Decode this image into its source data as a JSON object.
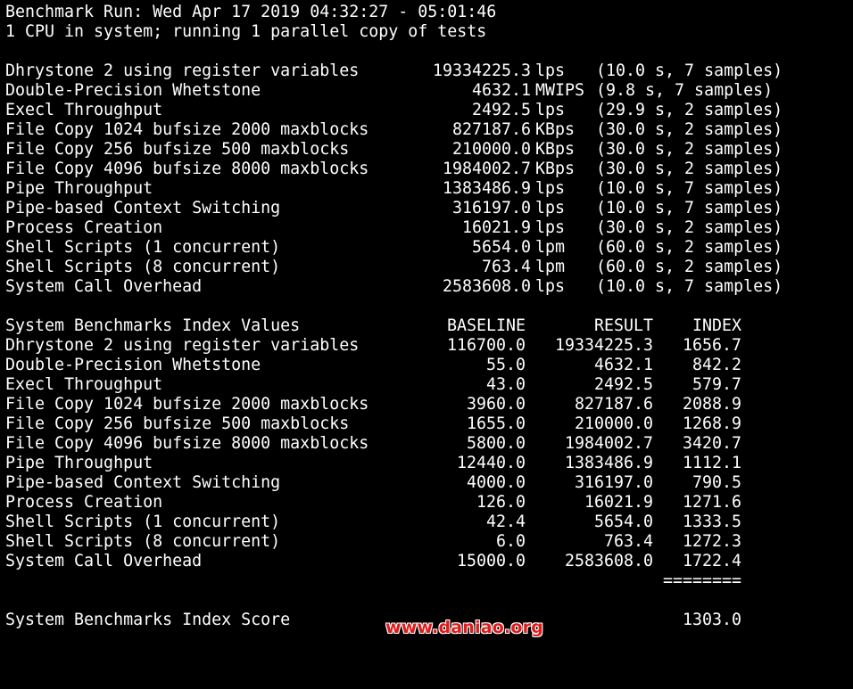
{
  "terminal": {
    "dashes": "--------------------------------------------------------------------------------",
    "run_line": "Benchmark Run: Wed Apr 17 2019 04:32:27 - 05:01:46",
    "cpu_line": "1 CPU in system; running 1 parallel copy of tests"
  },
  "tests": [
    {
      "name": "Dhrystone 2 using register variables",
      "value": "19334225.3",
      "unit": "lps",
      "info": "(10.0 s, 7 samples)"
    },
    {
      "name": "Double-Precision Whetstone",
      "value": "4632.1",
      "unit": "MWIPS",
      "info": "(9.8 s, 7 samples)"
    },
    {
      "name": "Execl Throughput",
      "value": "2492.5",
      "unit": "lps",
      "info": "(29.9 s, 2 samples)"
    },
    {
      "name": "File Copy 1024 bufsize 2000 maxblocks",
      "value": "827187.6",
      "unit": "KBps",
      "info": "(30.0 s, 2 samples)"
    },
    {
      "name": "File Copy 256 bufsize 500 maxblocks",
      "value": "210000.0",
      "unit": "KBps",
      "info": "(30.0 s, 2 samples)"
    },
    {
      "name": "File Copy 4096 bufsize 8000 maxblocks",
      "value": "1984002.7",
      "unit": "KBps",
      "info": "(30.0 s, 2 samples)"
    },
    {
      "name": "Pipe Throughput",
      "value": "1383486.9",
      "unit": "lps",
      "info": "(10.0 s, 7 samples)"
    },
    {
      "name": "Pipe-based Context Switching",
      "value": "316197.0",
      "unit": "lps",
      "info": "(10.0 s, 7 samples)"
    },
    {
      "name": "Process Creation",
      "value": "16021.9",
      "unit": "lps",
      "info": "(30.0 s, 2 samples)"
    },
    {
      "name": "Shell Scripts (1 concurrent)",
      "value": "5654.0",
      "unit": "lpm",
      "info": "(60.0 s, 2 samples)"
    },
    {
      "name": "Shell Scripts (8 concurrent)",
      "value": "763.4",
      "unit": "lpm",
      "info": "(60.0 s, 2 samples)"
    },
    {
      "name": "System Call Overhead",
      "value": "2583608.0",
      "unit": "lps",
      "info": "(10.0 s, 7 samples)"
    }
  ],
  "index": {
    "header": {
      "title": "System Benchmarks Index Values",
      "baseline": "BASELINE",
      "result": "RESULT",
      "index": "INDEX"
    },
    "rows": [
      {
        "name": "Dhrystone 2 using register variables",
        "baseline": "116700.0",
        "result": "19334225.3",
        "index": "1656.7"
      },
      {
        "name": "Double-Precision Whetstone",
        "baseline": "55.0",
        "result": "4632.1",
        "index": "842.2"
      },
      {
        "name": "Execl Throughput",
        "baseline": "43.0",
        "result": "2492.5",
        "index": "579.7"
      },
      {
        "name": "File Copy 1024 bufsize 2000 maxblocks",
        "baseline": "3960.0",
        "result": "827187.6",
        "index": "2088.9"
      },
      {
        "name": "File Copy 256 bufsize 500 maxblocks",
        "baseline": "1655.0",
        "result": "210000.0",
        "index": "1268.9"
      },
      {
        "name": "File Copy 4096 bufsize 8000 maxblocks",
        "baseline": "5800.0",
        "result": "1984002.7",
        "index": "3420.7"
      },
      {
        "name": "Pipe Throughput",
        "baseline": "12440.0",
        "result": "1383486.9",
        "index": "1112.1"
      },
      {
        "name": "Pipe-based Context Switching",
        "baseline": "4000.0",
        "result": "316197.0",
        "index": "790.5"
      },
      {
        "name": "Process Creation",
        "baseline": "126.0",
        "result": "16021.9",
        "index": "1271.6"
      },
      {
        "name": "Shell Scripts (1 concurrent)",
        "baseline": "42.4",
        "result": "5654.0",
        "index": "1333.5"
      },
      {
        "name": "Shell Scripts (8 concurrent)",
        "baseline": "6.0",
        "result": "763.4",
        "index": "1272.3"
      },
      {
        "name": "System Call Overhead",
        "baseline": "15000.0",
        "result": "2583608.0",
        "index": "1722.4"
      }
    ],
    "separator": "========",
    "score_label": "System Benchmarks Index Score",
    "score": "1303.0"
  },
  "watermark": "www.daniao.org",
  "colors": {
    "background": "#000000",
    "text": "#ffffff",
    "watermark": "#e01a1a"
  }
}
